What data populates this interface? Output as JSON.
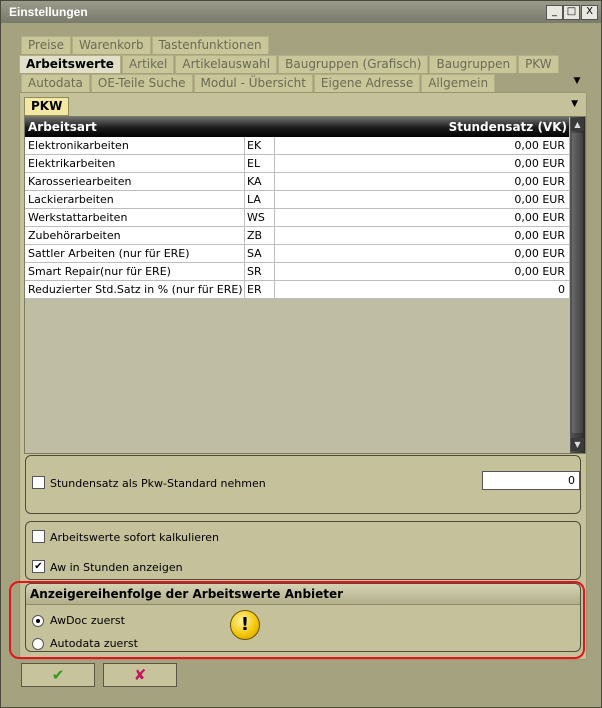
{
  "window": {
    "title": "Einstellungen"
  },
  "titlebar_buttons": {
    "minimize": "_",
    "maximize": "□",
    "close": "X"
  },
  "tabs": {
    "row1": [
      {
        "label": "Preise"
      },
      {
        "label": "Warenkorb"
      },
      {
        "label": "Tastenfunktionen"
      }
    ],
    "row2": [
      {
        "label": "Arbeitswerte"
      },
      {
        "label": "Artikel"
      },
      {
        "label": "Artikelauswahl"
      },
      {
        "label": "Baugruppen (Grafisch)"
      },
      {
        "label": "Baugruppen"
      },
      {
        "label": "PKW"
      }
    ],
    "row3": [
      {
        "label": "Autodata"
      },
      {
        "label": "OE-Teile Suche"
      },
      {
        "label": "Modul - Übersicht"
      },
      {
        "label": "Eigene Adresse"
      },
      {
        "label": "Allgemein"
      }
    ],
    "more_arrow": "▼"
  },
  "subtab": {
    "label": "PKW",
    "arrow": "▼"
  },
  "table": {
    "headers": {
      "arbeitsart": "Arbeitsart",
      "stundensatz": "Stundensatz (VK)"
    },
    "rows": [
      {
        "name": "Elektronikarbeiten",
        "code": "EK",
        "rate": "0,00 EUR"
      },
      {
        "name": "Elektrikarbeiten",
        "code": "EL",
        "rate": "0,00 EUR"
      },
      {
        "name": "Karosseriearbeiten",
        "code": "KA",
        "rate": "0,00 EUR"
      },
      {
        "name": "Lackierarbeiten",
        "code": "LA",
        "rate": "0,00 EUR"
      },
      {
        "name": "Werkstattarbeiten",
        "code": "WS",
        "rate": "0,00 EUR"
      },
      {
        "name": "Zubehörarbeiten",
        "code": "ZB",
        "rate": "0,00 EUR"
      },
      {
        "name": "Sattler Arbeiten (nur für ERE)",
        "code": "SA",
        "rate": "0,00 EUR"
      },
      {
        "name": "Smart Repair(nur für ERE)",
        "code": "SR",
        "rate": "0,00 EUR"
      },
      {
        "name": "Reduzierter Std.Satz in % (nur für ERE)",
        "code": "ER",
        "rate": "0"
      }
    ],
    "scroll_up": "▲",
    "scroll_down": "▼"
  },
  "standard_group": {
    "checkbox_label": "Stundensatz als Pkw-Standard nehmen",
    "checked": false,
    "value": "0"
  },
  "options_group": {
    "sofort_label": "Arbeitswerte sofort kalkulieren",
    "sofort_checked": false,
    "aw_label": "Aw in Stunden anzeigen",
    "aw_checked": true,
    "check_mark": "✔"
  },
  "order_group": {
    "title": "Anzeigereihenfolge der Arbeitswerte Anbieter",
    "option_awdoc": "AwDoc zuerst",
    "option_autodata": "Autodata zuerst",
    "selected": "awdoc",
    "info_glyph": "!"
  },
  "buttons": {
    "ok_glyph": "✔",
    "cancel_glyph": "✘",
    "ok_color": "#2f9a1e",
    "cancel_color": "#c2185b"
  }
}
